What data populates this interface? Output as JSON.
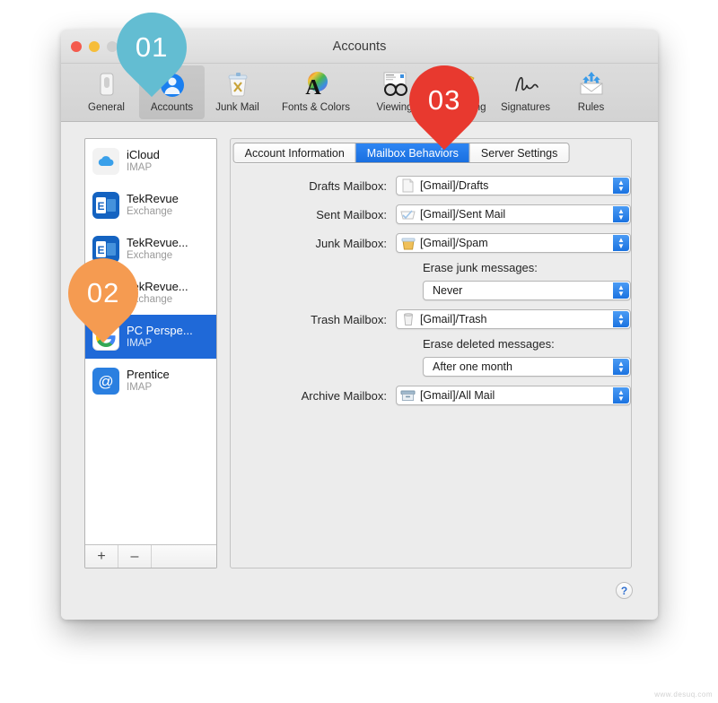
{
  "window": {
    "title": "Accounts",
    "traffic_lights": [
      "close",
      "minimize",
      "zoom-disabled"
    ]
  },
  "toolbar": {
    "items": [
      {
        "label": "General",
        "icon": "general-icon",
        "active": false
      },
      {
        "label": "Accounts",
        "icon": "accounts-icon",
        "active": true
      },
      {
        "label": "Junk Mail",
        "icon": "junk-mail-icon",
        "active": false
      },
      {
        "label": "Fonts & Colors",
        "icon": "fonts-colors-icon",
        "active": false
      },
      {
        "label": "Viewing",
        "icon": "viewing-icon",
        "active": false
      },
      {
        "label": "Composing",
        "icon": "composing-icon",
        "active": false
      },
      {
        "label": "Signatures",
        "icon": "signatures-icon",
        "active": false
      },
      {
        "label": "Rules",
        "icon": "rules-icon",
        "active": false
      }
    ]
  },
  "accounts": {
    "items": [
      {
        "name": "iCloud",
        "type": "IMAP",
        "icon": "icloud-icon",
        "selected": false
      },
      {
        "name": "TekRevue",
        "type": "Exchange",
        "icon": "exchange-icon",
        "selected": false
      },
      {
        "name": "TekRevue...",
        "type": "Exchange",
        "icon": "exchange-icon",
        "selected": false
      },
      {
        "name": "TekRevue...",
        "type": "Exchange",
        "icon": "exchange-icon",
        "selected": false
      },
      {
        "name": "PC Perspe...",
        "type": "IMAP",
        "icon": "gmail-icon",
        "selected": true
      },
      {
        "name": "Prentice",
        "type": "IMAP",
        "icon": "at-sign-icon",
        "selected": false
      }
    ],
    "add_label": "+",
    "remove_label": "–"
  },
  "tabs": [
    {
      "label": "Account Information",
      "active": false
    },
    {
      "label": "Mailbox Behaviors",
      "active": true
    },
    {
      "label": "Server Settings",
      "active": false
    }
  ],
  "form": {
    "drafts_label": "Drafts Mailbox:",
    "drafts_value": "[Gmail]/Drafts",
    "sent_label": "Sent Mailbox:",
    "sent_value": "[Gmail]/Sent Mail",
    "junk_label": "Junk Mailbox:",
    "junk_value": "[Gmail]/Spam",
    "erase_junk_label": "Erase junk messages:",
    "erase_junk_value": "Never",
    "trash_label": "Trash Mailbox:",
    "trash_value": "[Gmail]/Trash",
    "erase_deleted_label": "Erase deleted messages:",
    "erase_deleted_value": "After one month",
    "archive_label": "Archive Mailbox:",
    "archive_value": "[Gmail]/All Mail"
  },
  "help": {
    "label": "?"
  },
  "annotations": [
    {
      "id": "01",
      "color": "#63bdd2",
      "target": "accounts-toolbar-item"
    },
    {
      "id": "02",
      "color": "#f59b51",
      "target": "account-pc-perspective"
    },
    {
      "id": "03",
      "color": "#e8392f",
      "target": "mailbox-behaviors-tab"
    }
  ],
  "watermark": {
    "text": "www.desuq.com"
  },
  "colors": {
    "accent_blue": "#1f69d8",
    "popup_arrow": "#1b73e0",
    "window_bg": "#ececec"
  }
}
